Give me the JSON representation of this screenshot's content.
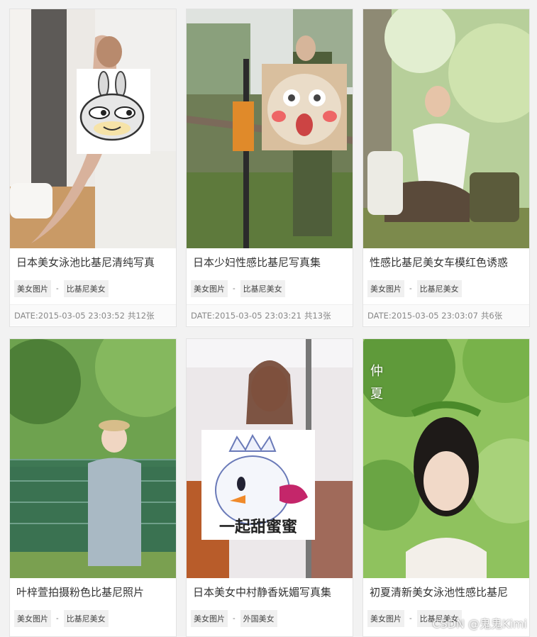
{
  "cards": [
    {
      "title": "日本美女泳池比基尼清纯写真",
      "tag1": "美女图片",
      "sep": "-",
      "tag2": "比基尼美女",
      "date": "DATE:2015-03-05 23:03:52",
      "count": "共12张",
      "photo_colors": [
        "#eae7e3",
        "#b99a86"
      ]
    },
    {
      "title": "日本少妇性感比基尼写真集",
      "tag1": "美女图片",
      "sep": "-",
      "tag2": "比基尼美女",
      "date": "DATE:2015-03-05 23:03:21",
      "count": "共13张",
      "photo_colors": [
        "#9db08a",
        "#556045"
      ]
    },
    {
      "title": "性感比基尼美女车模红色诱惑",
      "tag1": "美女图片",
      "sep": "-",
      "tag2": "比基尼美女",
      "date": "DATE:2015-03-05 23:03:07",
      "count": "共6张",
      "photo_colors": [
        "#a9c48e",
        "#6f7f4e"
      ]
    },
    {
      "title": "叶梓萱拍摄粉色比基尼照片",
      "tag1": "美女图片",
      "sep": "-",
      "tag2": "比基尼美女",
      "photo_colors": [
        "#6f9a55",
        "#3d6a38"
      ]
    },
    {
      "title": "日本美女中村静香妩媚写真集",
      "tag1": "美女图片",
      "sep": "-",
      "tag2": "外国美女",
      "photo_colors": [
        "#e8e4e6",
        "#a46a5a"
      ],
      "sticker_text": "一起甜蜜蜜"
    },
    {
      "title": "初夏清新美女泳池性感比基尼",
      "tag1": "美女图片",
      "sep": "-",
      "tag2": "比基尼美女",
      "photo_colors": [
        "#88bb55",
        "#4c8a34"
      ],
      "photo_text": [
        "仲",
        "夏"
      ]
    }
  ],
  "watermark": "CSDN @鬼鬼Kimi"
}
